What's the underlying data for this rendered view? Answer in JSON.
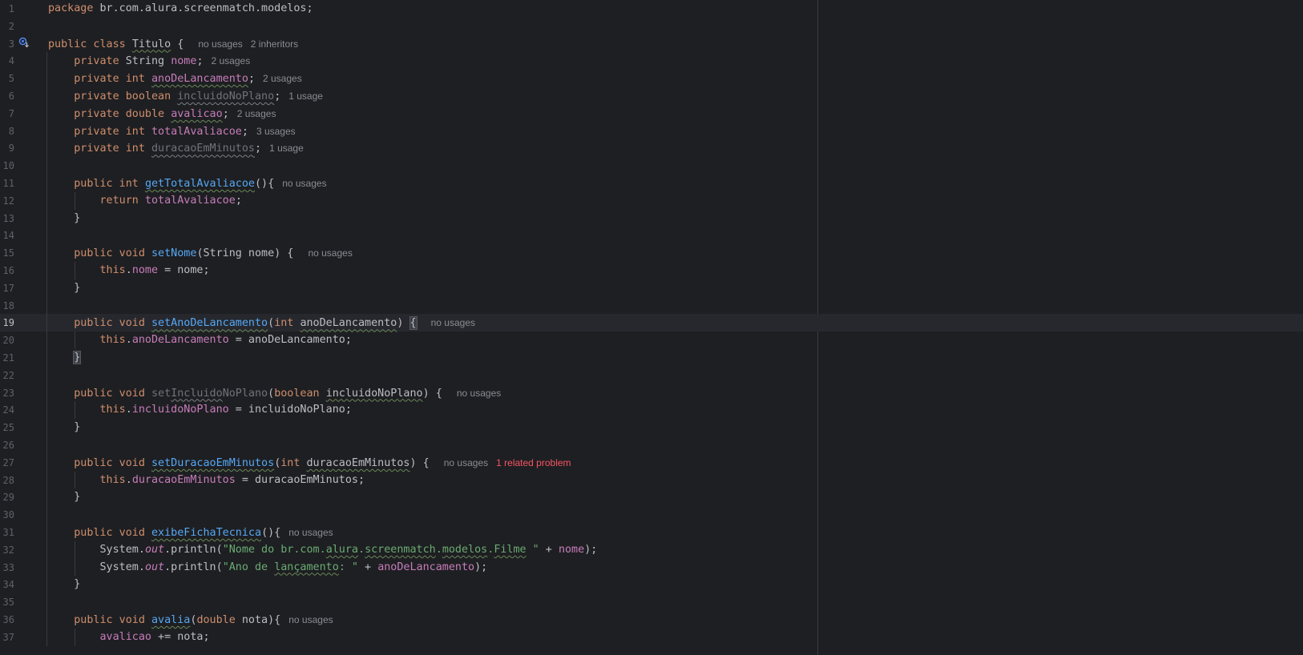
{
  "editor": {
    "lines": [
      {
        "n": "1",
        "tokens": [
          [
            "kw",
            "package "
          ],
          [
            "",
            "br.com.alura.screenmatch.modelos;"
          ]
        ]
      },
      {
        "n": "2",
        "tokens": []
      },
      {
        "n": "3",
        "tokens": [
          [
            "kw",
            "public class "
          ],
          [
            "wavy",
            "Titulo"
          ],
          [
            "",
            " { "
          ]
        ],
        "hints": [
          "no usages",
          "2 inheritors"
        ]
      },
      {
        "n": "4",
        "tokens": [
          [
            "kw",
            "    private "
          ],
          [
            "",
            "String "
          ],
          [
            "fld",
            "nome"
          ],
          [
            "",
            ";"
          ]
        ],
        "hints": [
          "2 usages"
        ]
      },
      {
        "n": "5",
        "tokens": [
          [
            "kw",
            "    private int "
          ],
          [
            "fld wavy",
            "anoDeLancamento"
          ],
          [
            "",
            ";"
          ]
        ],
        "hints": [
          "2 usages"
        ]
      },
      {
        "n": "6",
        "tokens": [
          [
            "kw",
            "    private boolean "
          ],
          [
            "unused wavy-dim",
            "incluidoNoPlano"
          ],
          [
            "",
            ";"
          ]
        ],
        "hints": [
          "1 usage"
        ]
      },
      {
        "n": "7",
        "tokens": [
          [
            "kw",
            "    private double "
          ],
          [
            "fld wavy",
            "avalicao"
          ],
          [
            "",
            ";"
          ]
        ],
        "hints": [
          "2 usages"
        ]
      },
      {
        "n": "8",
        "tokens": [
          [
            "kw",
            "    private int "
          ],
          [
            "fld",
            "totalAvaliacoe"
          ],
          [
            "",
            ";"
          ]
        ],
        "hints": [
          "3 usages"
        ]
      },
      {
        "n": "9",
        "tokens": [
          [
            "kw",
            "    private int "
          ],
          [
            "unused wavy-dim",
            "duracaoEmMinutos"
          ],
          [
            "",
            ";"
          ]
        ],
        "hints": [
          "1 usage"
        ]
      },
      {
        "n": "10",
        "tokens": []
      },
      {
        "n": "11",
        "tokens": [
          [
            "kw",
            "    public int "
          ],
          [
            "fn wavy",
            "getTotalAvaliacoe"
          ],
          [
            "",
            "(){"
          ]
        ],
        "hints": [
          "no usages"
        ]
      },
      {
        "n": "12",
        "tokens": [
          [
            "kw",
            "        return "
          ],
          [
            "fld",
            "totalAvaliacoe"
          ],
          [
            "",
            ";"
          ]
        ]
      },
      {
        "n": "13",
        "tokens": [
          [
            "",
            "    }"
          ]
        ]
      },
      {
        "n": "14",
        "tokens": []
      },
      {
        "n": "15",
        "tokens": [
          [
            "kw",
            "    public void "
          ],
          [
            "fn",
            "setNome"
          ],
          [
            "",
            "(String nome) { "
          ]
        ],
        "hints": [
          "no usages"
        ]
      },
      {
        "n": "16",
        "tokens": [
          [
            "kw",
            "        this"
          ],
          [
            "",
            "."
          ],
          [
            "fld",
            "nome"
          ],
          [
            "",
            " = nome;"
          ]
        ]
      },
      {
        "n": "17",
        "tokens": [
          [
            "",
            "    }"
          ]
        ]
      },
      {
        "n": "18",
        "tokens": []
      },
      {
        "n": "19",
        "current": true,
        "tokens": [
          [
            "kw",
            "    public void "
          ],
          [
            "fn wavy",
            "setAnoDeLancamento"
          ],
          [
            "",
            "("
          ],
          [
            "kw",
            "int "
          ],
          [
            "wavy",
            "anoDeLancamento"
          ],
          [
            "",
            ") "
          ],
          [
            "brace-hl",
            "{"
          ],
          [
            "",
            " "
          ]
        ],
        "hints": [
          "no usages"
        ]
      },
      {
        "n": "20",
        "tokens": [
          [
            "kw",
            "        this"
          ],
          [
            "",
            "."
          ],
          [
            "fld",
            "anoDeLancamento"
          ],
          [
            "",
            " = anoDeLancamento;"
          ]
        ]
      },
      {
        "n": "21",
        "tokens": [
          [
            "",
            "    "
          ],
          [
            "brace-hl",
            "}"
          ]
        ]
      },
      {
        "n": "22",
        "tokens": []
      },
      {
        "n": "23",
        "tokens": [
          [
            "kw",
            "    public void "
          ],
          [
            "unused",
            "set"
          ],
          [
            "unused wavy-dim",
            "Incluido"
          ],
          [
            "unused",
            "NoPlano"
          ],
          [
            "",
            "("
          ],
          [
            "kw",
            "boolean "
          ],
          [
            "wavy",
            "incluidoNoPlano"
          ],
          [
            "",
            ") { "
          ]
        ],
        "hints": [
          "no usages"
        ]
      },
      {
        "n": "24",
        "tokens": [
          [
            "kw",
            "        this"
          ],
          [
            "",
            "."
          ],
          [
            "fld",
            "incluidoNoPlano"
          ],
          [
            "",
            " = incluidoNoPlano;"
          ]
        ]
      },
      {
        "n": "25",
        "tokens": [
          [
            "",
            "    }"
          ]
        ]
      },
      {
        "n": "26",
        "tokens": []
      },
      {
        "n": "27",
        "tokens": [
          [
            "kw",
            "    public void "
          ],
          [
            "fn wavy",
            "setDuracaoEmMinutos"
          ],
          [
            "",
            "("
          ],
          [
            "kw",
            "int "
          ],
          [
            "wavy",
            "duracaoEmMinutos"
          ],
          [
            "",
            ") { "
          ]
        ],
        "hints": [
          "no usages"
        ],
        "problem": "1 related problem"
      },
      {
        "n": "28",
        "tokens": [
          [
            "kw",
            "        this"
          ],
          [
            "",
            "."
          ],
          [
            "fld",
            "duracaoEmMinutos"
          ],
          [
            "",
            " = duracaoEmMinutos;"
          ]
        ]
      },
      {
        "n": "29",
        "tokens": [
          [
            "",
            "    }"
          ]
        ]
      },
      {
        "n": "30",
        "tokens": []
      },
      {
        "n": "31",
        "tokens": [
          [
            "kw",
            "    public void "
          ],
          [
            "fn wavy",
            "exibeFichaTecnica"
          ],
          [
            "",
            "(){"
          ]
        ],
        "hints": [
          "no usages"
        ]
      },
      {
        "n": "32",
        "tokens": [
          [
            "",
            "        System."
          ],
          [
            "static",
            "out"
          ],
          [
            "",
            ".println("
          ],
          [
            "str",
            "\"Nome do br.com."
          ],
          [
            "str wavy",
            "alura"
          ],
          [
            "str",
            "."
          ],
          [
            "str wavy",
            "screenmatch"
          ],
          [
            "str",
            "."
          ],
          [
            "str wavy",
            "modelos"
          ],
          [
            "str",
            "."
          ],
          [
            "str wavy",
            "Filme"
          ],
          [
            "str",
            " \""
          ],
          [
            "",
            " + "
          ],
          [
            "fld",
            "nome"
          ],
          [
            "",
            ");"
          ]
        ]
      },
      {
        "n": "33",
        "tokens": [
          [
            "",
            "        System."
          ],
          [
            "static",
            "out"
          ],
          [
            "",
            ".println("
          ],
          [
            "str",
            "\"Ano de "
          ],
          [
            "str wavy",
            "lançamento"
          ],
          [
            "str",
            ": \""
          ],
          [
            "",
            " + "
          ],
          [
            "fld",
            "anoDeLancamento"
          ],
          [
            "",
            ");"
          ]
        ]
      },
      {
        "n": "34",
        "tokens": [
          [
            "",
            "    }"
          ]
        ]
      },
      {
        "n": "35",
        "tokens": []
      },
      {
        "n": "36",
        "tokens": [
          [
            "kw",
            "    public void "
          ],
          [
            "fn wavy",
            "avalia"
          ],
          [
            "",
            "("
          ],
          [
            "kw",
            "double "
          ],
          [
            "",
            "nota){"
          ]
        ],
        "hints": [
          "no usages"
        ]
      },
      {
        "n": "37",
        "tokens": [
          [
            "fld",
            "        avalicao"
          ],
          [
            "",
            " += nota;"
          ]
        ]
      }
    ]
  }
}
